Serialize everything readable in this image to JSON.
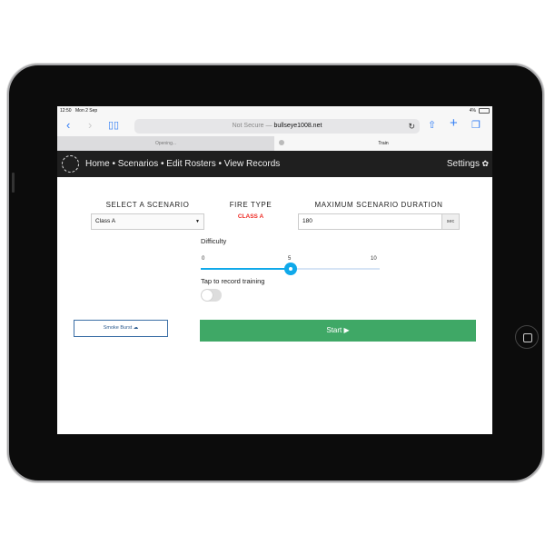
{
  "status": {
    "time": "12:50",
    "date": "Mon 2 Sep",
    "battery": "4%"
  },
  "browser": {
    "url_prefix": "Not Secure —",
    "url_domain": "bullseye1008.net",
    "tabs": [
      {
        "label": "Opening..."
      },
      {
        "label": "Train"
      }
    ]
  },
  "nav": {
    "links": "Home • Scenarios • Edit Rosters • View Records",
    "settings": "Settings"
  },
  "form": {
    "scenario_heading": "SELECT A SCENARIO",
    "scenario_value": "Class A",
    "fire_type_heading": "FIRE TYPE",
    "fire_type_value": "CLASS A",
    "fire_type_color": "#ee2b24",
    "duration_heading": "MAXIMUM SCENARIO DURATION",
    "duration_value": "180",
    "duration_unit": "sec",
    "difficulty_label": "Difficulty",
    "difficulty_min": "0",
    "difficulty_mid": "5",
    "difficulty_max": "10",
    "difficulty_value": 5,
    "record_label": "Tap to record training",
    "record_on": false,
    "smoke_button": "Smoke Burst",
    "start_button": "Start ▶",
    "start_color": "#3fa866",
    "accent": "#10a9ea"
  }
}
